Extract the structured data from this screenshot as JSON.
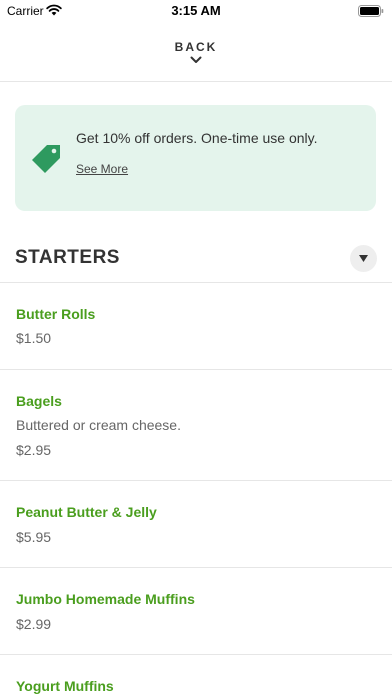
{
  "status_bar": {
    "carrier": "Carrier",
    "time": "3:15 AM"
  },
  "nav": {
    "back_label": "BACK"
  },
  "promo": {
    "text": "Get 10% off orders. One-time use only.",
    "link_label": "See More",
    "background": "#e4f4ec",
    "icon_color": "#2e9a5f"
  },
  "section": {
    "title": "STARTERS"
  },
  "accent_color": "#4a9e1e",
  "items": [
    {
      "name": "Butter Rolls",
      "description": "",
      "price": "$1.50"
    },
    {
      "name": "Bagels",
      "description": "Buttered or cream cheese.",
      "price": "$2.95"
    },
    {
      "name": "Peanut Butter & Jelly",
      "description": "",
      "price": "$5.95"
    },
    {
      "name": "Jumbo Homemade Muffins",
      "description": "",
      "price": "$2.99"
    },
    {
      "name": "Yogurt Muffins",
      "description": "",
      "price": ""
    }
  ]
}
